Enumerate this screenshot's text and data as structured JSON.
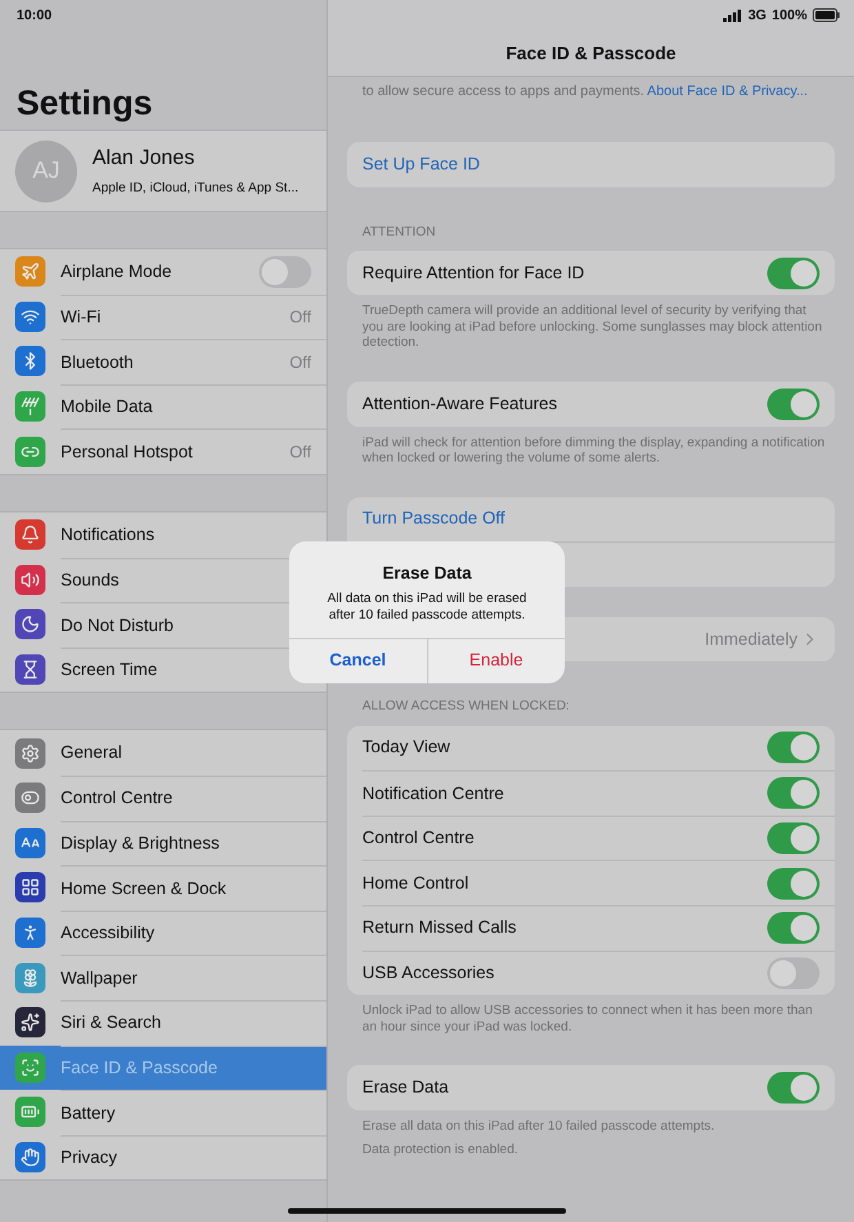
{
  "status_bar": {
    "time": "10:00",
    "network": "3G",
    "battery": "100%"
  },
  "sidebar": {
    "title": "Settings",
    "profile": {
      "initials": "AJ",
      "name": "Alan Jones",
      "subtitle": "Apple ID, iCloud, iTunes & App St..."
    },
    "groups": [
      {
        "items": [
          {
            "label": "Airplane Mode",
            "kind": "toggle",
            "on": false,
            "color": "#d9861a",
            "selected": false
          },
          {
            "label": "Wi-Fi",
            "kind": "value",
            "value": "Off",
            "color": "#1d6fd0",
            "selected": false
          },
          {
            "label": "Bluetooth",
            "kind": "value",
            "value": "Off",
            "color": "#1d6fd0",
            "selected": false
          },
          {
            "label": "Mobile Data",
            "kind": "plain",
            "color": "#30a64a",
            "selected": false
          },
          {
            "label": "Personal Hotspot",
            "kind": "value",
            "value": "Off",
            "color": "#30a64a",
            "selected": false
          }
        ]
      },
      {
        "items": [
          {
            "label": "Notifications",
            "kind": "plain",
            "color": "#d5392f",
            "selected": false
          },
          {
            "label": "Sounds",
            "kind": "plain",
            "color": "#d4304c",
            "selected": false
          },
          {
            "label": "Do Not Disturb",
            "kind": "plain",
            "color": "#5046b5",
            "selected": false
          },
          {
            "label": "Screen Time",
            "kind": "plain",
            "color": "#5046b5",
            "selected": false
          }
        ]
      },
      {
        "items": [
          {
            "label": "General",
            "kind": "plain",
            "color": "#7b7b7d",
            "selected": false
          },
          {
            "label": "Control Centre",
            "kind": "plain",
            "color": "#7b7b7d",
            "selected": false
          },
          {
            "label": "Display & Brightness",
            "kind": "plain",
            "color": "#1d6fd0",
            "selected": false
          },
          {
            "label": "Home Screen & Dock",
            "kind": "plain",
            "color": "#2a3cae",
            "selected": false
          },
          {
            "label": "Accessibility",
            "kind": "plain",
            "color": "#1d6fd0",
            "selected": false
          },
          {
            "label": "Wallpaper",
            "kind": "plain",
            "color": "#3a9abd",
            "selected": false
          },
          {
            "label": "Siri & Search",
            "kind": "plain",
            "color": "#26263a",
            "selected": false
          },
          {
            "label": "Face ID & Passcode",
            "kind": "plain",
            "color": "#30a64a",
            "selected": true
          },
          {
            "label": "Battery",
            "kind": "plain",
            "color": "#30a64a",
            "selected": false
          },
          {
            "label": "Privacy",
            "kind": "plain",
            "color": "#1d6fd0",
            "selected": false
          }
        ]
      }
    ]
  },
  "detail": {
    "title": "Face ID & Passcode",
    "intro": {
      "text": "to allow secure access to apps and payments.",
      "link": "About Face ID & Privacy..."
    },
    "sections": [
      {
        "rows": [
          {
            "kind": "link",
            "label": "Set Up Face ID"
          }
        ]
      },
      {
        "header": "ATTENTION",
        "rows": [
          {
            "kind": "toggle",
            "label": "Require Attention for Face ID",
            "on": true
          }
        ],
        "footer": [
          "TrueDepth camera will provide an additional level of security by verifying that you are looking at iPad before unlocking. Some sunglasses may block attention detection."
        ]
      },
      {
        "rows": [
          {
            "kind": "toggle",
            "label": "Attention-Aware Features",
            "on": true
          }
        ],
        "footer": [
          "iPad will check for attention before dimming the display, expanding a notification when locked or lowering the volume of some alerts."
        ]
      },
      {
        "rows": [
          {
            "kind": "link",
            "label": "Turn Passcode Off"
          },
          {
            "kind": "blank"
          }
        ]
      },
      {
        "rows": [
          {
            "kind": "value",
            "value": "Immediately"
          }
        ]
      },
      {
        "header": "ALLOW ACCESS WHEN LOCKED:",
        "rows": [
          {
            "kind": "toggle",
            "label": "Today View",
            "on": true
          },
          {
            "kind": "toggle",
            "label": "Notification Centre",
            "on": true
          },
          {
            "kind": "toggle",
            "label": "Control Centre",
            "on": true
          },
          {
            "kind": "toggle",
            "label": "Home Control",
            "on": true
          },
          {
            "kind": "toggle",
            "label": "Return Missed Calls",
            "on": true
          },
          {
            "kind": "toggle",
            "label": "USB Accessories",
            "on": false
          }
        ],
        "footer": [
          "Unlock iPad to allow USB accessories to connect when it has been more than an hour since your iPad was locked."
        ]
      },
      {
        "rows": [
          {
            "kind": "toggle",
            "label": "Erase Data",
            "on": true
          }
        ],
        "footer": [
          "Erase all data on this iPad after 10 failed passcode attempts.",
          "Data protection is enabled."
        ]
      }
    ]
  },
  "alert": {
    "title": "Erase Data",
    "message": "All data on this iPad will be erased after 10 failed passcode attempts.",
    "buttons": [
      {
        "label": "Cancel",
        "kind": "cancel"
      },
      {
        "label": "Enable",
        "kind": "destructive"
      }
    ]
  }
}
